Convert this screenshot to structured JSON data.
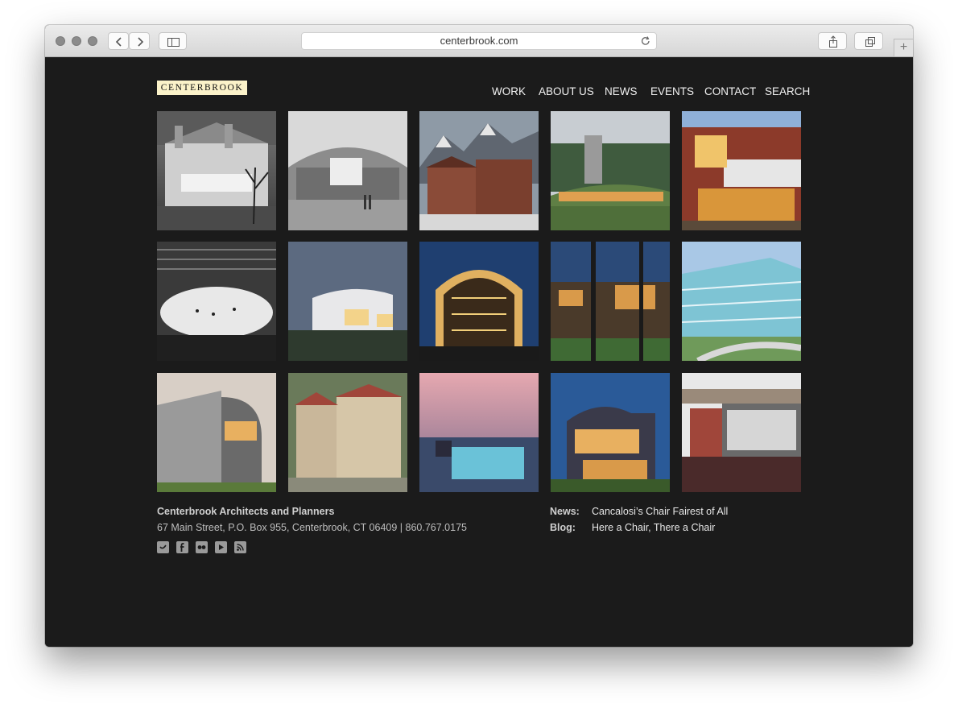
{
  "browser": {
    "url": "centerbrook.com"
  },
  "site": {
    "logo": "CENTERBROOK",
    "nav": [
      "WORK",
      "ABOUT US",
      "NEWS",
      "EVENTS",
      "CONTACT",
      "SEARCH"
    ]
  },
  "footer": {
    "company": "Centerbrook Architects and Planners",
    "address": "67 Main Street, P.O. Box 955, Centerbrook, CT 06409 | 860.767.0175",
    "social": [
      "twitter-icon",
      "facebook-icon",
      "flickr-icon",
      "youtube-icon",
      "rss-icon"
    ],
    "news_label": "News:",
    "news_link": "Cancalosi’s Chair Fairest of All",
    "blog_label": "Blog:",
    "blog_link": "Here a Chair, There a Chair"
  },
  "colors": {
    "page_bg": "#1b1b1b",
    "logo_bg": "#fbf2c9",
    "nav_text": "#f2f2f2"
  }
}
